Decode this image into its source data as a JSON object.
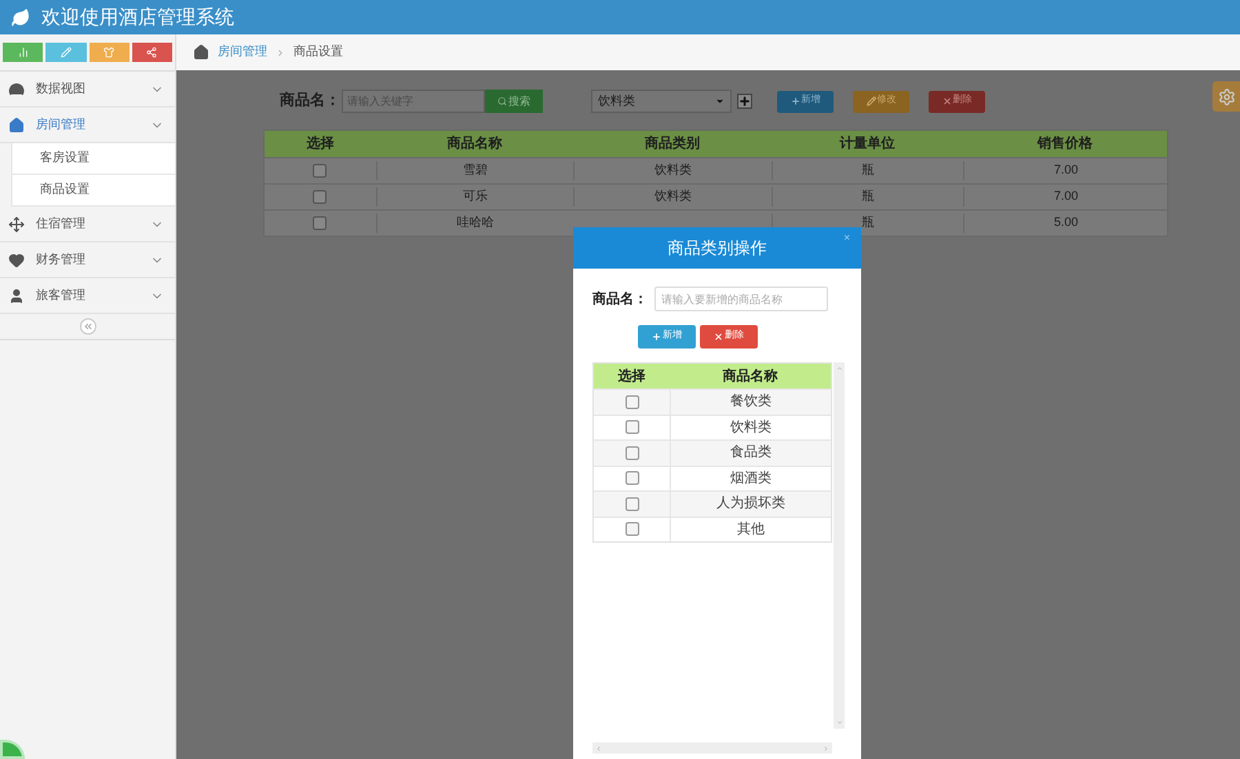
{
  "header": {
    "title": "欢迎使用酒店管理系统"
  },
  "shortcuts": [
    {
      "color": "#5cb85c"
    },
    {
      "color": "#5bc0de"
    },
    {
      "color": "#f0ad4e"
    },
    {
      "color": "#d9534f"
    }
  ],
  "sidebar": {
    "items": [
      {
        "label": "数据视图",
        "selected": false
      },
      {
        "label": "房间管理",
        "selected": true,
        "expanded": true,
        "children": [
          {
            "label": "客房设置",
            "selected": false
          },
          {
            "label": "商品设置",
            "selected": false
          }
        ]
      },
      {
        "label": "住宿管理",
        "selected": false
      },
      {
        "label": "财务管理",
        "selected": false
      },
      {
        "label": "旅客管理",
        "selected": false
      }
    ]
  },
  "breadcrumb": [
    "房间管理",
    "商品设置"
  ],
  "filter": {
    "label": "商品名：",
    "placeholder": "请输入关键字",
    "search_button": "搜索",
    "category": "饮料类",
    "buttons": [
      {
        "kind": "add",
        "label": "新增"
      },
      {
        "kind": "edit",
        "label": "修改"
      },
      {
        "kind": "delete",
        "label": "删除"
      }
    ]
  },
  "table": {
    "columns": [
      "选择",
      "商品名称",
      "商品类别",
      "计量单位",
      "销售价格"
    ],
    "rows": [
      {
        "checked": false,
        "name": "雪碧",
        "category": "饮料类",
        "unit": "瓶",
        "price": "7.00"
      },
      {
        "checked": false,
        "name": "可乐",
        "category": "饮料类",
        "unit": "瓶",
        "price": "7.00"
      },
      {
        "checked": false,
        "name": "哇哈哈",
        "unit": "瓶",
        "price": "5.00"
      }
    ]
  },
  "dialog": {
    "title": "商品类别操作",
    "close": "×",
    "label": "商品名：",
    "placeholder": "请输入要新增的商品名称",
    "buttons": [
      {
        "kind": "add",
        "label": "新增"
      },
      {
        "kind": "delete",
        "label": "删除"
      }
    ],
    "columns": [
      "选择",
      "商品名称"
    ],
    "rows": [
      {
        "checked": false,
        "name": "餐饮类"
      },
      {
        "checked": false,
        "name": "饮料类"
      },
      {
        "checked": false,
        "name": "食品类"
      },
      {
        "checked": false,
        "name": "烟酒类"
      },
      {
        "checked": false,
        "name": "人为损坏类"
      },
      {
        "checked": false,
        "name": "其他"
      }
    ]
  }
}
